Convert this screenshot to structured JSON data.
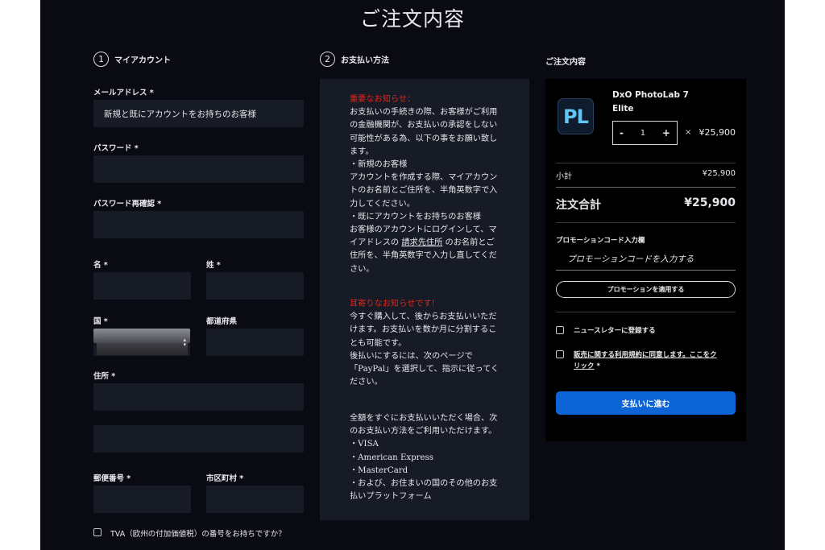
{
  "title": "ご注文内容",
  "steps": {
    "account": {
      "num": "1",
      "label": "マイアカウント"
    },
    "payment": {
      "num": "2",
      "label": "お支払い方法"
    },
    "summary": {
      "label": "ご注文内容"
    }
  },
  "form": {
    "email_label": "メールアドレス *",
    "email_value": "新規と既にアカウントをお持ちのお客様",
    "password_label": "パスワード *",
    "password_confirm_label": "パスワード再確認 *",
    "first_name_label": "名 *",
    "last_name_label": "姓 *",
    "country_label": "国 *",
    "prefecture_label": "都道府県",
    "address_label": "住所 *",
    "postal_label": "郵便番号 *",
    "city_label": "市区町村 *",
    "tva_label": "TVA（欧州の付加価値税）の番号をお持ちですか？"
  },
  "payment_info": {
    "notice1_heading": "重要なお知らせ：",
    "notice1_lines": [
      "お支払いの手続きの際、お客様がご利用",
      "の金融機関が、お支払いの承認をしない",
      "可能性がある為、以下の事をお願い致し",
      "ます。",
      "・新規のお客様",
      "アカウントを作成する際、マイアカウン",
      "トのお名前とご住所を、半角英数字で入",
      "力してください。",
      "・既にアカウントをお持ちのお客様",
      "お客様のアカウントにログインして、マ"
    ],
    "notice1_pre_link": "イアドレスの ",
    "notice1_link": "請求先住所",
    "notice1_post_link": " のお名前とご",
    "notice1_end_lines": [
      "住所を、半角英数字で入力し直してくだ",
      "さい。"
    ],
    "notice2_heading": "耳寄りなお知らせです!",
    "notice2_lines": [
      "今すぐ購入して、後からお支払いいただ",
      "けます。お支払いを数か月に分割するこ",
      "とも可能です。",
      "後払いにするには、次のページで",
      "「PayPal」を選択して、指示に従ってく",
      "ださい。"
    ],
    "notice3_lines": [
      "全額をすぐにお支払いいただく場合、次",
      "のお支払い方法をご利用いただけます。",
      "・VISA",
      "・American Express",
      "・MasterCard",
      "・および、お住まいの国のその他のお支",
      "払いプラットフォーム"
    ]
  },
  "summary": {
    "product_icon_text": "PL",
    "product_name": "DxO PhotoLab 7",
    "product_edition": "Elite",
    "qty_minus": "-",
    "qty_value": "1",
    "qty_plus": "+",
    "times": "×",
    "unit_price": "¥25,900",
    "subtotal_label": "小計",
    "subtotal_value": "¥25,900",
    "total_label": "注文合計",
    "total_value": "¥25,900",
    "promo_label": "プロモーションコード入力欄",
    "promo_placeholder": "プロモーションコードを入力する",
    "promo_button": "プロモーションを適用する",
    "newsletter_label": "ニュースレターに登録する",
    "terms_link": "販売に関する利用規約に同意します。ここをク",
    "terms_link2": "リック",
    "terms_star": " *",
    "pay_button": "支払いに進む"
  },
  "colors": {
    "page_bg": "#0a0a12",
    "panel_bg": "#171b26",
    "accent_blue": "#0c64d6",
    "notice_red": "#e0261c"
  },
  "icons": [
    "photolab-app-icon",
    "select-arrows-icon"
  ]
}
